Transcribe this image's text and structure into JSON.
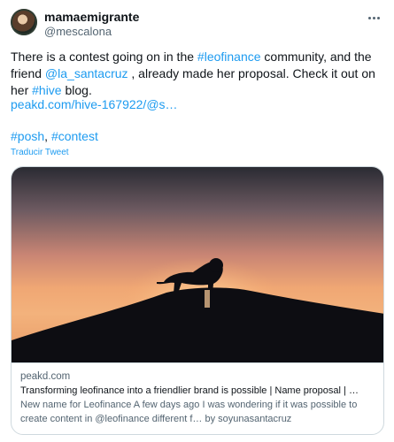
{
  "author": {
    "display_name": "mamaemigrante",
    "handle": "@mescalona"
  },
  "tweet": {
    "text_1": "There is a contest going on in the ",
    "hashtag_leofinance": "#leofinance",
    "text_2": " community, and the friend ",
    "mention": "@la_santacruz",
    "text_3": " , already made her proposal. Check it out on her ",
    "hashtag_hive": "#hive",
    "text_4": " blog.",
    "url": "peakd.com/hive-167922/@s…",
    "hashtag_posh": "#posh",
    "separator": ", ",
    "hashtag_contest": "#contest",
    "translate_label": "Traducir Tweet"
  },
  "card": {
    "domain": "peakd.com",
    "title": "Transforming leofinance into a friendlier brand is possible | Name proposal | …",
    "description": "New name for Leofinance A few days ago I was wondering if it was possible to create content in @leofinance different f… by soyunasantacruz"
  },
  "icons": {
    "more": "more-horizontal-icon"
  },
  "colors": {
    "link": "#1d9bf0",
    "text": "#0f1419",
    "secondary": "#536471",
    "border": "#cfd9de"
  }
}
